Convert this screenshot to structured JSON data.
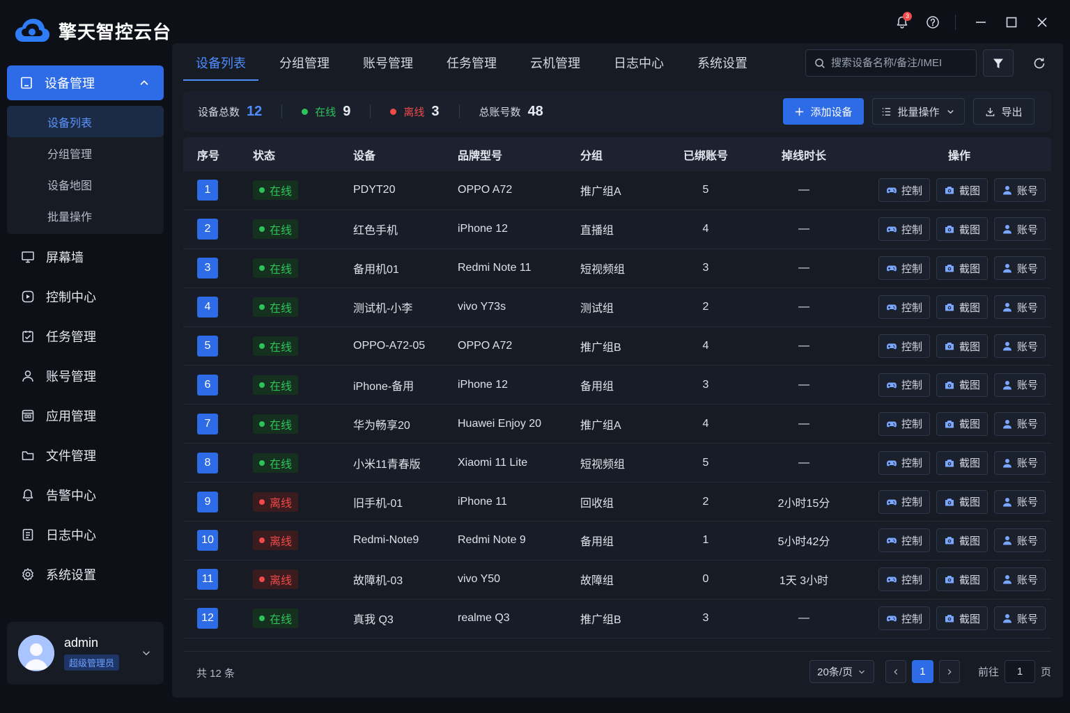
{
  "app": {
    "title": "擎天智控云台",
    "notification_count": "3"
  },
  "sidebar": {
    "parent": {
      "label": "设备管理"
    },
    "sub_items": [
      {
        "label": "设备列表",
        "active": true
      },
      {
        "label": "分组管理"
      },
      {
        "label": "设备地图"
      },
      {
        "label": "批量操作"
      }
    ],
    "items": [
      {
        "label": "屏幕墙",
        "icon": "monitor-icon"
      },
      {
        "label": "控制中心",
        "icon": "control-icon"
      },
      {
        "label": "任务管理",
        "icon": "task-icon"
      },
      {
        "label": "账号管理",
        "icon": "user-icon"
      },
      {
        "label": "应用管理",
        "icon": "app-icon"
      },
      {
        "label": "文件管理",
        "icon": "folder-icon"
      },
      {
        "label": "告警中心",
        "icon": "bell-icon"
      },
      {
        "label": "日志中心",
        "icon": "log-icon"
      },
      {
        "label": "系统设置",
        "icon": "gear-icon"
      }
    ],
    "user": {
      "name": "admin",
      "role": "超级管理员"
    }
  },
  "tabs": [
    "设备列表",
    "分组管理",
    "账号管理",
    "任务管理",
    "云机管理",
    "日志中心",
    "系统设置"
  ],
  "search": {
    "placeholder": "搜索设备名称/备注/IMEI",
    "value": ""
  },
  "stats": {
    "total_label": "设备总数",
    "total": "12",
    "online_label": "在线",
    "online": "9",
    "offline_label": "离线",
    "offline": "3",
    "accounts_label": "总账号数",
    "accounts": "48"
  },
  "actions": {
    "add": "添加设备",
    "batch": "批量操作",
    "export": "导出"
  },
  "table": {
    "headers": {
      "idx": "序号",
      "status": "状态",
      "device": "设备",
      "brand": "品牌型号",
      "group": "分组",
      "accounts": "已绑账号",
      "offline": "掉线时长",
      "ops": "操作"
    },
    "op_labels": {
      "control": "控制",
      "screenshot": "截图",
      "account": "账号"
    },
    "rows": [
      {
        "idx": "1",
        "status": "在线",
        "online": true,
        "device": "PDYT20",
        "brand": "OPPO A72",
        "group": "推广组A",
        "accounts": "5",
        "offline": "—"
      },
      {
        "idx": "2",
        "status": "在线",
        "online": true,
        "device": "红色手机",
        "brand": "iPhone 12",
        "group": "直播组",
        "accounts": "4",
        "offline": "—"
      },
      {
        "idx": "3",
        "status": "在线",
        "online": true,
        "device": "备用机01",
        "brand": "Redmi Note 11",
        "group": "短视频组",
        "accounts": "3",
        "offline": "—"
      },
      {
        "idx": "4",
        "status": "在线",
        "online": true,
        "device": "测试机-小李",
        "brand": "vivo Y73s",
        "group": "测试组",
        "accounts": "2",
        "offline": "—"
      },
      {
        "idx": "5",
        "status": "在线",
        "online": true,
        "device": "OPPO-A72-05",
        "brand": "OPPO A72",
        "group": "推广组B",
        "accounts": "4",
        "offline": "—"
      },
      {
        "idx": "6",
        "status": "在线",
        "online": true,
        "device": "iPhone-备用",
        "brand": "iPhone 12",
        "group": "备用组",
        "accounts": "3",
        "offline": "—"
      },
      {
        "idx": "7",
        "status": "在线",
        "online": true,
        "device": "华为畅享20",
        "brand": "Huawei Enjoy 20",
        "group": "推广组A",
        "accounts": "4",
        "offline": "—"
      },
      {
        "idx": "8",
        "status": "在线",
        "online": true,
        "device": "小米11青春版",
        "brand": "Xiaomi 11 Lite",
        "group": "短视频组",
        "accounts": "5",
        "offline": "—"
      },
      {
        "idx": "9",
        "status": "离线",
        "online": false,
        "device": "旧手机-01",
        "brand": "iPhone 11",
        "group": "回收组",
        "accounts": "2",
        "offline": "2小时15分"
      },
      {
        "idx": "10",
        "status": "离线",
        "online": false,
        "device": "Redmi-Note9",
        "brand": "Redmi Note 9",
        "group": "备用组",
        "accounts": "1",
        "offline": "5小时42分"
      },
      {
        "idx": "11",
        "status": "离线",
        "online": false,
        "device": "故障机-03",
        "brand": "vivo Y50",
        "group": "故障组",
        "accounts": "0",
        "offline": "1天 3小时"
      },
      {
        "idx": "12",
        "status": "在线",
        "online": true,
        "device": "真我 Q3",
        "brand": "realme Q3",
        "group": "推广组B",
        "accounts": "3",
        "offline": "—"
      }
    ]
  },
  "footer": {
    "total_text": "共 12 条",
    "page_size": "20条/页",
    "current_page": "1",
    "goto_label": "前往",
    "goto_value": "1",
    "page_suffix": "页"
  },
  "colors": {
    "accent": "#2e6be6",
    "online": "#2fc25b",
    "offline": "#f04a4a",
    "background": "#0d1117"
  }
}
